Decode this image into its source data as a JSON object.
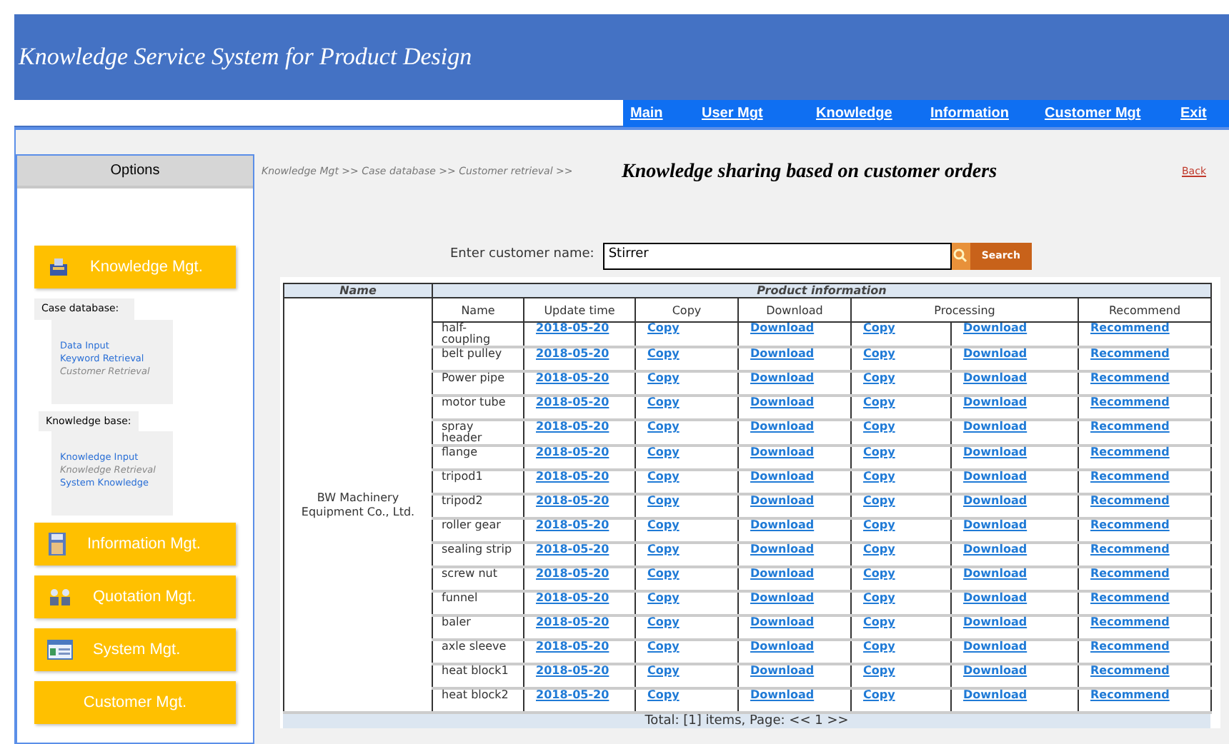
{
  "header": {
    "title": "Knowledge Service System for Product Design"
  },
  "nav": [
    {
      "label": "Main"
    },
    {
      "label": "User Mgt"
    },
    {
      "label": "Knowledge"
    },
    {
      "label": "Information"
    },
    {
      "label": "Customer Mgt"
    },
    {
      "label": "Exit"
    }
  ],
  "sidebar": {
    "title": "Options",
    "menus": [
      {
        "kind": "knowledge",
        "label": "Knowledge Mgt.",
        "groups": [
          {
            "label": "Case database:",
            "items": [
              {
                "label": "Data Input",
                "current": false
              },
              {
                "label": "Keyword Retrieval",
                "current": false
              },
              {
                "label": "Customer Retrieval",
                "current": true
              }
            ]
          },
          {
            "label": "Knowledge base:",
            "items": [
              {
                "label": "Knowledge Input",
                "current": false
              },
              {
                "label": "Knowledge Retrieval",
                "current": true
              },
              {
                "label": "System Knowledge",
                "current": false
              }
            ]
          }
        ]
      },
      {
        "kind": "information",
        "label": "Information Mgt."
      },
      {
        "kind": "quotation",
        "label": "Quotation Mgt."
      },
      {
        "kind": "system",
        "label": "System Mgt."
      },
      {
        "kind": "none",
        "label": "Customer Mgt."
      }
    ]
  },
  "breadcrumb": "Knowledge Mgt >> Case database >> Customer retrieval >>",
  "page_title": "Knowledge sharing based on customer orders",
  "back_link": "Back",
  "search": {
    "label": "Enter customer name:",
    "value": "Stirrer",
    "button": "Search"
  },
  "table": {
    "group_headers": [
      "Name",
      "Product information"
    ],
    "columns": [
      "Name",
      "Update time",
      "Copy",
      "Download",
      "Processing",
      "Recommend"
    ],
    "customer": "BW Machinery Equipment Co., Ltd.",
    "rows": [
      {
        "name": "half-coupling",
        "update_time": "2018-05-20",
        "copy": "Copy",
        "download": "Download",
        "processing_copy": "Copy",
        "processing_download": "Download",
        "recommend": "Recommend"
      },
      {
        "name": "belt pulley",
        "update_time": "2018-05-20",
        "copy": "Copy",
        "download": "Download",
        "processing_copy": "Copy",
        "processing_download": "Download",
        "recommend": "Recommend"
      },
      {
        "name": "Power pipe",
        "update_time": "2018-05-20",
        "copy": "Copy",
        "download": "Download",
        "processing_copy": "Copy",
        "processing_download": "Download",
        "recommend": "Recommend"
      },
      {
        "name": "motor tube",
        "update_time": "2018-05-20",
        "copy": "Copy",
        "download": "Download",
        "processing_copy": "Copy",
        "processing_download": "Download",
        "recommend": "Recommend"
      },
      {
        "name": "spray header",
        "update_time": "2018-05-20",
        "copy": "Copy",
        "download": "Download",
        "processing_copy": "Copy",
        "processing_download": "Download",
        "recommend": "Recommend"
      },
      {
        "name": "flange",
        "update_time": "2018-05-20",
        "copy": "Copy",
        "download": "Download",
        "processing_copy": "Copy",
        "processing_download": "Download",
        "recommend": "Recommend"
      },
      {
        "name": "tripod1",
        "update_time": "2018-05-20",
        "copy": "Copy",
        "download": "Download",
        "processing_copy": "Copy",
        "processing_download": "Download",
        "recommend": "Recommend"
      },
      {
        "name": "tripod2",
        "update_time": "2018-05-20",
        "copy": "Copy",
        "download": "Download",
        "processing_copy": "Copy",
        "processing_download": "Download",
        "recommend": "Recommend"
      },
      {
        "name": "roller gear",
        "update_time": "2018-05-20",
        "copy": "Copy",
        "download": "Download",
        "processing_copy": "Copy",
        "processing_download": "Download",
        "recommend": "Recommend"
      },
      {
        "name": "sealing strip",
        "update_time": "2018-05-20",
        "copy": "Copy",
        "download": "Download",
        "processing_copy": "Copy",
        "processing_download": "Download",
        "recommend": "Recommend"
      },
      {
        "name": "screw nut",
        "update_time": "2018-05-20",
        "copy": "Copy",
        "download": "Download",
        "processing_copy": "Copy",
        "processing_download": "Download",
        "recommend": "Recommend"
      },
      {
        "name": "funnel",
        "update_time": "2018-05-20",
        "copy": "Copy",
        "download": "Download",
        "processing_copy": "Copy",
        "processing_download": "Download",
        "recommend": "Recommend"
      },
      {
        "name": "baler",
        "update_time": "2018-05-20",
        "copy": "Copy",
        "download": "Download",
        "processing_copy": "Copy",
        "processing_download": "Download",
        "recommend": "Recommend"
      },
      {
        "name": "axle sleeve",
        "update_time": "2018-05-20",
        "copy": "Copy",
        "download": "Download",
        "processing_copy": "Copy",
        "processing_download": "Download",
        "recommend": "Recommend"
      },
      {
        "name": "heat block1",
        "update_time": "2018-05-20",
        "copy": "Copy",
        "download": "Download",
        "processing_copy": "Copy",
        "processing_download": "Download",
        "recommend": "Recommend"
      },
      {
        "name": "heat block2",
        "update_time": "2018-05-20",
        "copy": "Copy",
        "download": "Download",
        "processing_copy": "Copy",
        "processing_download": "Download",
        "recommend": "Recommend"
      }
    ],
    "footer": "Total: [1] items, Page: << 1 >>"
  }
}
